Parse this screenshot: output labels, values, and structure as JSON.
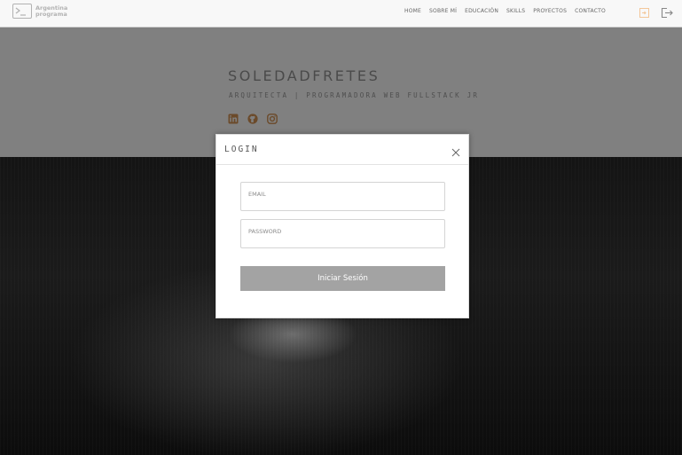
{
  "navbar": {
    "logo_line1": "Argentina",
    "logo_line2": "programa",
    "links": [
      "HOME",
      "SOBRE MÍ",
      "EDUCACIÓN",
      "SKILLS",
      "PROYECTOS",
      "CONTACTO"
    ],
    "icons": [
      "login-icon",
      "logout-icon"
    ],
    "accent_color": "#f0a050"
  },
  "hero": {
    "title": "SOLEDADFRETES",
    "subtitle": "ARQUITECTA | PROGRAMADORA WEB FULLSTACK JR",
    "social_icons": [
      "linkedin-icon",
      "github-icon",
      "instagram-icon"
    ],
    "social_color": "#6b4a2a"
  },
  "modal": {
    "title": "LOGIN",
    "email_placeholder": "EMAIL",
    "password_placeholder": "PASSWORD",
    "submit_label": "Iniciar Sesión"
  }
}
